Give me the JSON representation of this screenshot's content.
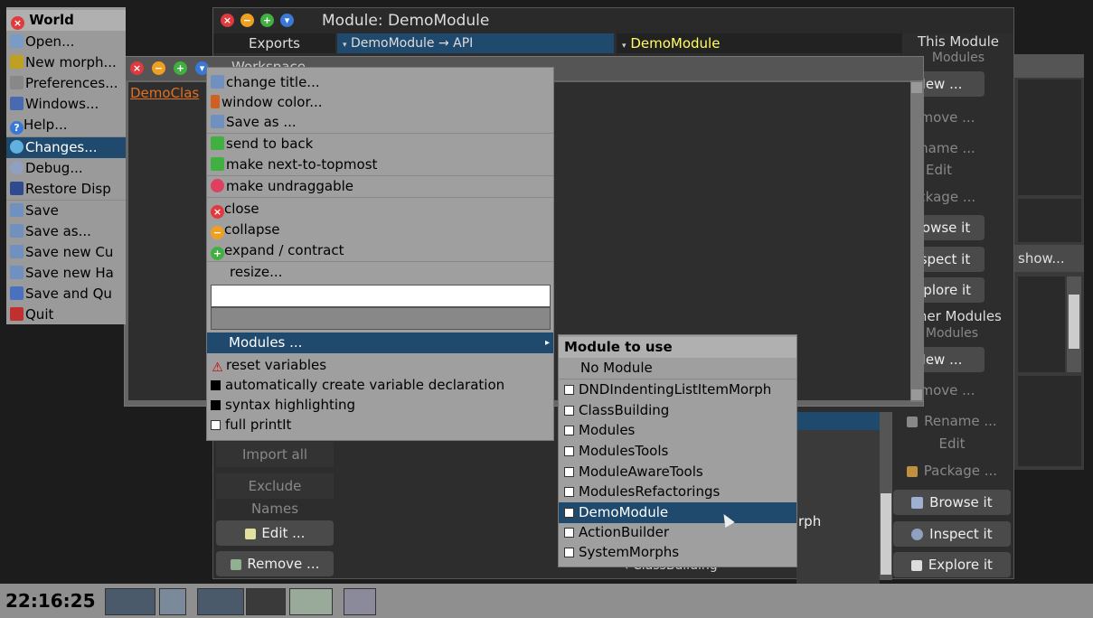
{
  "world_menu": {
    "title": "World",
    "items": [
      {
        "label": "Open...",
        "icon": "folder-icon"
      },
      {
        "label": "New morph...",
        "icon": "new-morph-icon"
      },
      {
        "label": "Preferences...",
        "icon": "wrench-icon"
      },
      {
        "label": "Windows...",
        "icon": "window-icon"
      },
      {
        "label": "Help...",
        "icon": "help-icon"
      },
      {
        "label": "Changes...",
        "icon": "changes-icon"
      },
      {
        "label": "Debug...",
        "icon": "debug-icon"
      },
      {
        "label": "Restore Disp",
        "icon": "monitor-icon"
      },
      {
        "label": "Save",
        "icon": "save-icon"
      },
      {
        "label": "Save as...",
        "icon": "save-as-icon"
      },
      {
        "label": "Save new Cu",
        "icon": "save-new-icon"
      },
      {
        "label": "Save new Ha",
        "icon": "save-new-icon"
      },
      {
        "label": "Save and Qu",
        "icon": "save-quit-icon"
      },
      {
        "label": "Quit",
        "icon": "quit-icon"
      }
    ]
  },
  "module_window": {
    "title": "Module: DemoModule",
    "exports_label": "Exports",
    "exports_path": "DemoModule → API",
    "selected_module": "DemoModule",
    "right_header": "This Module",
    "right_sub": "Modules",
    "right_buttons_top": [
      "New ...",
      "Remove ...",
      "Rename ...",
      "Edit",
      "Package ...",
      "Browse it",
      "Inspect it",
      "Explore it"
    ],
    "other_header": "Other Modules",
    "other_sub": "Modules",
    "right_buttons_bottom": [
      "New ...",
      "Remove ...",
      "Rename ...",
      "Edit",
      "Package ...",
      "Browse it",
      "Inspect it",
      "Explore it"
    ],
    "left_buttons": [
      "Import all",
      "Exclude",
      "Names",
      "Edit ...",
      "Remove ..."
    ],
    "list_fragment": "rph",
    "list_bottom": "ClassBuilding",
    "show_button": "show..."
  },
  "workspace": {
    "title": "Workspace",
    "link_text": "DemoClas"
  },
  "context_menu": {
    "items": [
      {
        "label": "change title...",
        "icon": "title-icon"
      },
      {
        "label": "window color...",
        "icon": "brush-icon"
      },
      {
        "label": "Save as ...",
        "icon": "save-icon"
      },
      {
        "label": "send to back",
        "icon": "arrow-down-icon"
      },
      {
        "label": "make next-to-topmost",
        "icon": "arrow-up-icon"
      },
      {
        "label": "make undraggable",
        "icon": "pin-icon"
      },
      {
        "label": "close",
        "icon": "close-icon"
      },
      {
        "label": "collapse",
        "icon": "collapse-icon"
      },
      {
        "label": "expand / contract",
        "icon": "expand-icon"
      },
      {
        "label": "resize..."
      }
    ],
    "modules_label": "Modules ...",
    "reset_label": "reset variables",
    "check_items": [
      {
        "label": "automatically create variable declaration",
        "checked": true
      },
      {
        "label": "syntax highlighting",
        "checked": true
      },
      {
        "label": "full printIt",
        "checked": false
      }
    ]
  },
  "module_menu": {
    "title": "Module to use",
    "no_module": "No Module",
    "items": [
      "DNDIndentingListItemMorph",
      "ClassBuilding",
      "Modules",
      "ModulesTools",
      "ModuleAwareTools",
      "ModulesRefactorings",
      "DemoModule",
      "ActionBuilder",
      "SystemMorphs"
    ],
    "selected": "DemoModule"
  },
  "taskbar": {
    "clock": "22:16:25"
  },
  "colors": {
    "selection": "#1f4a6e",
    "accent_link": "#e07020",
    "highlight_yellow": "#ffff60"
  }
}
